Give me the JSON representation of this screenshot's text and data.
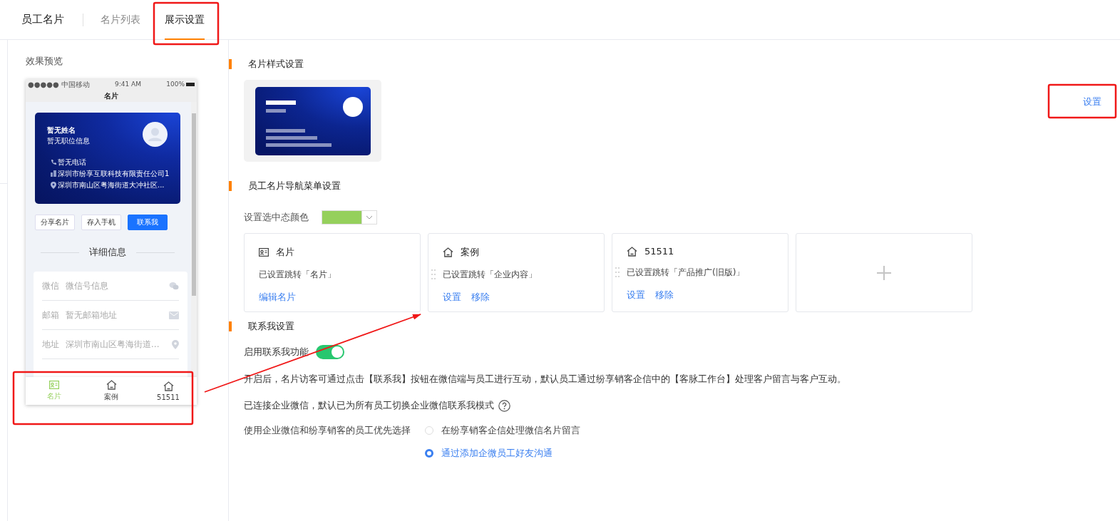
{
  "header": {
    "title": "员工名片",
    "tabs": [
      {
        "label": "名片列表",
        "selected": false
      },
      {
        "label": "展示设置",
        "selected": true
      }
    ]
  },
  "preview": {
    "title": "效果预览",
    "phone": {
      "status_bar": {
        "carrier": "●●●●● 中国移动",
        "time": "9:41 AM",
        "battery": "100%"
      },
      "page_title": "名片",
      "card": {
        "name": "暂无姓名",
        "position": "暂无职位信息",
        "lines": [
          {
            "kind": "phone",
            "text": "暂无电话"
          },
          {
            "kind": "company",
            "text": "深圳市纷享互联科技有限责任公司1"
          },
          {
            "kind": "address",
            "text": "深圳市南山区粤海街道大冲社区..."
          }
        ]
      },
      "buttons": [
        {
          "label": "分享名片",
          "primary": false
        },
        {
          "label": "存入手机",
          "primary": false
        },
        {
          "label": "联系我",
          "primary": true
        }
      ],
      "section_title": "详细信息",
      "details": [
        {
          "kind": "wechat",
          "label": "微信",
          "value": "微信号信息"
        },
        {
          "kind": "mail",
          "label": "邮箱",
          "value": "暂无邮箱地址"
        },
        {
          "kind": "location",
          "label": "地址",
          "value": "深圳市南山区粤海街道..."
        }
      ],
      "tabbar": [
        {
          "kind": "card",
          "label": "名片",
          "selected": true
        },
        {
          "kind": "home",
          "label": "案例",
          "selected": false
        },
        {
          "kind": "home",
          "label": "51511",
          "selected": false
        }
      ]
    }
  },
  "card_style": {
    "title": "名片样式设置",
    "action": "设置"
  },
  "nav_menu": {
    "title": "员工名片导航菜单设置",
    "color_label": "设置选中态颜色",
    "color": "#95d05c",
    "items": [
      {
        "kind": "card",
        "name": "名片",
        "target": "已设置跳转「名片」",
        "draggable": false,
        "actions": [
          "编辑名片"
        ]
      },
      {
        "kind": "home",
        "name": "案例",
        "target": "已设置跳转「企业内容」",
        "draggable": true,
        "actions": [
          "设置",
          "移除"
        ]
      },
      {
        "kind": "home",
        "name": "51511",
        "target": "已设置跳转「产品推广(旧版)」",
        "draggable": true,
        "actions": [
          "设置",
          "移除"
        ]
      }
    ]
  },
  "contact": {
    "title": "联系我设置",
    "enable_label": "启用联系我功能",
    "enabled": true,
    "description": "开启后，名片访客可通过点击【联系我】按钮在微信端与员工进行互动，默认员工通过纷享销客企信中的【客脉工作台】处理客户留言与客户互动。",
    "wecom_note": "已连接企业微信，默认已为所有员工切换企业微信联系我模式",
    "priority_label": "使用企业微信和纷享销客的员工优先选择",
    "options": [
      {
        "label": "在纷享销客企信处理微信名片留言",
        "selected": false
      },
      {
        "label": "通过添加企微员工好友沟通",
        "selected": true
      }
    ]
  }
}
